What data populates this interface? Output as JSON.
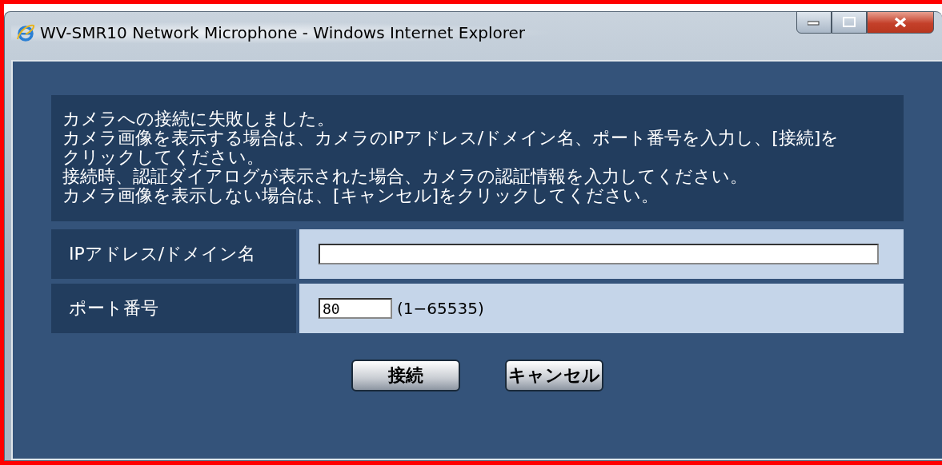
{
  "window": {
    "title": "WV-SMR10 Network Microphone - Windows Internet Explorer"
  },
  "message": [
    "カメラへの接続に失敗しました。",
    "カメラ画像を表示する場合は、カメラのIPアドレス/ドメイン名、ポート番号を入力し、[接続]を",
    "クリックしてください。",
    "接続時、認証ダイアログが表示された場合、カメラの認証情報を入力してください。",
    "カメラ画像を表示しない場合は、[キャンセル]をクリックしてください。"
  ],
  "form": [
    {
      "label": "IPアドレス/ドメイン名",
      "kind": "wide"
    },
    {
      "label": "ポート番号",
      "kind": "port",
      "value": "80",
      "hint": "(1−65535)"
    }
  ],
  "buttons": [
    "接続",
    "キャンセル"
  ]
}
